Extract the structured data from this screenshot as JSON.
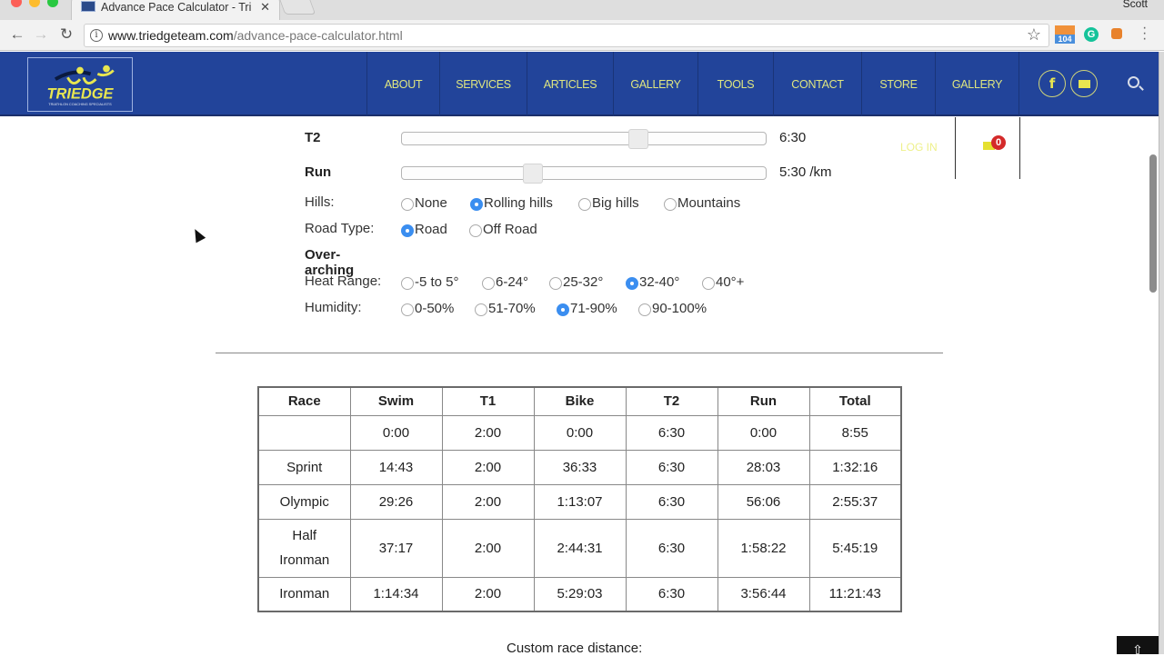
{
  "browser": {
    "tab_title": "Advance Pace Calculator - Tri",
    "profile_name": "Scott",
    "url_domain": "www.triedgeteam.com",
    "url_path": "/advance-pace-calculator.html",
    "extensions": {
      "mail_count": "104",
      "grammarly_letter": "G"
    }
  },
  "site": {
    "logo_text": "TRIEDGE",
    "logo_subtitle": "TRIATHLON COACHING SPECIALISTS",
    "colors": {
      "header_bg": "#22449a",
      "nav_text": "#dfe680",
      "accent_radio": "#3b8ef0"
    },
    "nav": [
      "ABOUT",
      "SERVICES",
      "ARTICLES",
      "GALLERY",
      "TOOLS",
      "CONTACT",
      "STORE",
      "GALLERY"
    ],
    "social": {
      "facebook_glyph": "f"
    },
    "login_label": "LOG IN",
    "cart_count": "0"
  },
  "form": {
    "sliders": [
      {
        "label": "T2",
        "value": "6:30",
        "fraction": 0.65
      },
      {
        "label": "Run",
        "value": "5:30 /km",
        "fraction": 0.36
      }
    ],
    "hills": {
      "label": "Hills:",
      "options": [
        "None",
        "Rolling hills",
        "Big hills",
        "Mountains"
      ],
      "selected": "Rolling hills"
    },
    "road_type": {
      "label": "Road Type:",
      "options": [
        "Road",
        "Off Road"
      ],
      "selected": "Road"
    },
    "section_title": "Over-arching",
    "heat_range": {
      "label": "Heat Range:",
      "options": [
        "-5 to 5°",
        "6-24°",
        "25-32°",
        "32-40°",
        "40°+"
      ],
      "selected": "32-40°"
    },
    "humidity": {
      "label": "Humidity:",
      "options": [
        "0-50%",
        "51-70%",
        "71-90%",
        "90-100%"
      ],
      "selected": "71-90%"
    }
  },
  "table": {
    "headers": [
      "Race",
      "Swim",
      "T1",
      "Bike",
      "T2",
      "Run",
      "Total"
    ],
    "rows": [
      [
        "",
        "0:00",
        "2:00",
        "0:00",
        "6:30",
        "0:00",
        "8:55"
      ],
      [
        "Sprint",
        "14:43",
        "2:00",
        "36:33",
        "6:30",
        "28:03",
        "1:32:16"
      ],
      [
        "Olympic",
        "29:26",
        "2:00",
        "1:13:07",
        "6:30",
        "56:06",
        "2:55:37"
      ],
      [
        "Half Ironman",
        "37:17",
        "2:00",
        "2:44:31",
        "6:30",
        "1:58:22",
        "5:45:19"
      ],
      [
        "Ironman",
        "1:14:34",
        "2:00",
        "5:29:03",
        "6:30",
        "3:56:44",
        "11:21:43"
      ]
    ]
  },
  "custom_race_label": "Custom race distance:"
}
